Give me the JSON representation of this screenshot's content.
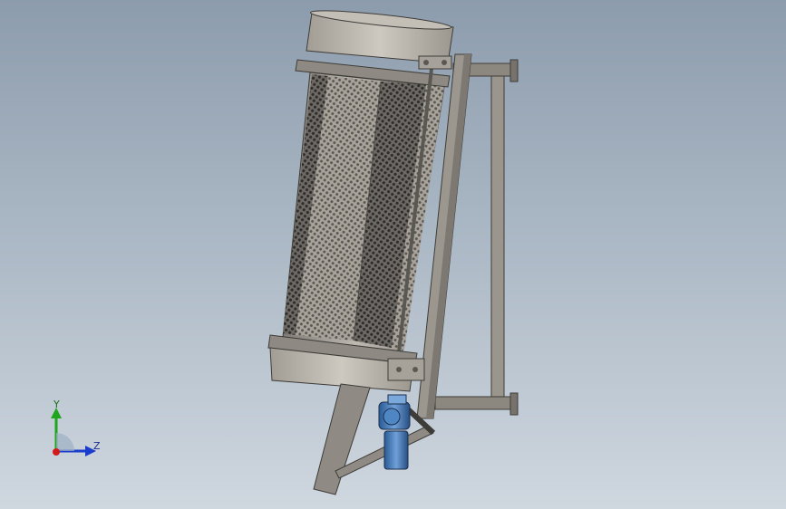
{
  "viewport": {
    "description_colors": {
      "background_top": "#8d9cad",
      "background_bottom": "#cfd7df",
      "metal": "#8f8a82",
      "motor": "#3d6fa8"
    }
  },
  "triad": {
    "y_label": "Y",
    "z_label": "Z",
    "y_axis_color": "#1fa51f",
    "z_axis_color": "#1a3ccc",
    "x_axis_color": "#d11a1a"
  }
}
